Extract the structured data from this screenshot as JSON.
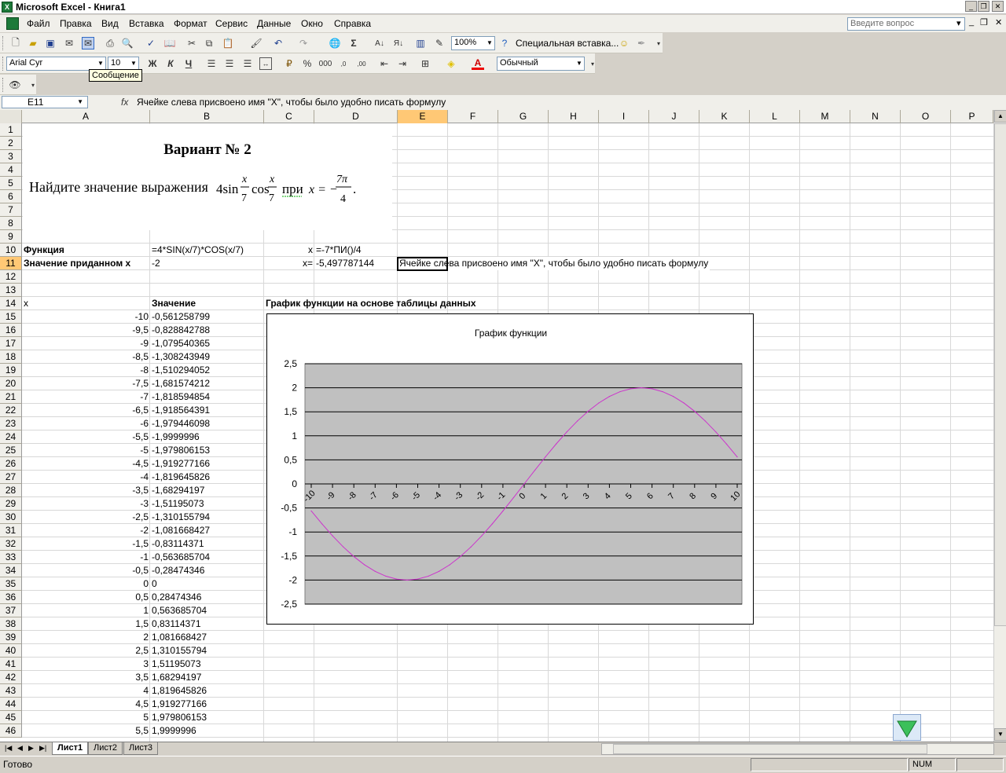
{
  "window": {
    "title": "Microsoft Excel - Книга1"
  },
  "menu": {
    "items": [
      "Файл",
      "Правка",
      "Вид",
      "Вставка",
      "Формат",
      "Сервис",
      "Данные",
      "Окно",
      "Справка"
    ],
    "ask_placeholder": "Введите вопрос"
  },
  "toolbar1": {
    "zoom": "100%",
    "special_paste": "Специальная вставка..."
  },
  "toolbar2": {
    "font": "Arial Cyr",
    "size": "10",
    "style": "Обычный"
  },
  "tooltip": "Сообщение",
  "formula_bar": {
    "cell_ref": "E11",
    "fx": "fx",
    "formula": "Ячейке слева присвоено имя \"X\", чтобы было удобно писать формулу"
  },
  "columns": [
    "A",
    "B",
    "C",
    "D",
    "E",
    "F",
    "G",
    "H",
    "I",
    "J",
    "K",
    "L",
    "M",
    "N",
    "O",
    "P"
  ],
  "rows": [
    "1",
    "2",
    "3",
    "4",
    "5",
    "6",
    "7",
    "8",
    "9",
    "10",
    "11",
    "12",
    "13",
    "14",
    "15",
    "16",
    "17",
    "18",
    "19",
    "20",
    "21",
    "22",
    "23",
    "24",
    "25",
    "26",
    "27",
    "28",
    "29",
    "30",
    "31",
    "32",
    "33",
    "34",
    "35",
    "36",
    "37",
    "38",
    "39",
    "40",
    "41",
    "42",
    "43",
    "44",
    "45",
    "46"
  ],
  "picture": {
    "heading": "Вариант № 2",
    "task_text": "Найдите значение выражения",
    "f_4sin": "4sin",
    "f_x": "x",
    "f_7": "7",
    "f_cos": "cos",
    "f_pri": "при",
    "f_xeq": "x = −",
    "f_7pi": "7π",
    "f_4": "4"
  },
  "cells": {
    "a10": "Функция",
    "b10": "=4*SIN(x/7)*COS(x/7)",
    "c10": "x",
    "d10": "=-7*ПИ()/4",
    "a11": "Значение приданном x",
    "b11": "-2",
    "c11": "x=",
    "d11": "-5,497787144",
    "e11": "Ячейке слева присвоено имя \"X\", чтобы было удобно писать формулу",
    "a14": "x",
    "b14": "Значение",
    "c14": "График функции на основе таблицы данных"
  },
  "table": {
    "x": [
      "-10",
      "-9,5",
      "-9",
      "-8,5",
      "-8",
      "-7,5",
      "-7",
      "-6,5",
      "-6",
      "-5,5",
      "-5",
      "-4,5",
      "-4",
      "-3,5",
      "-3",
      "-2,5",
      "-2",
      "-1,5",
      "-1",
      "-0,5",
      "0",
      "0,5",
      "1",
      "1,5",
      "2",
      "2,5",
      "3",
      "3,5",
      "4",
      "4,5",
      "5",
      "5,5"
    ],
    "y": [
      "-0,561258799",
      "-0,828842788",
      "-1,079540365",
      "-1,308243949",
      "-1,510294052",
      "-1,681574212",
      "-1,818594854",
      "-1,918564391",
      "-1,979446098",
      "-1,9999996",
      "-1,979806153",
      "-1,919277166",
      "-1,819645826",
      "-1,68294197",
      "-1,51195073",
      "-1,310155794",
      "-1,081668427",
      "-0,83114371",
      "-0,563685704",
      "-0,28474346",
      "0",
      "0,28474346",
      "0,563685704",
      "0,83114371",
      "1,081668427",
      "1,310155794",
      "1,51195073",
      "1,68294197",
      "1,819645826",
      "1,919277166",
      "1,979806153",
      "1,9999996"
    ]
  },
  "chart_data": {
    "type": "line",
    "title": "График функции",
    "x": [
      -10,
      -9.5,
      -9,
      -8.5,
      -8,
      -7.5,
      -7,
      -6.5,
      -6,
      -5.5,
      -5,
      -4.5,
      -4,
      -3.5,
      -3,
      -2.5,
      -2,
      -1.5,
      -1,
      -0.5,
      0,
      0.5,
      1,
      1.5,
      2,
      2.5,
      3,
      3.5,
      4,
      4.5,
      5,
      5.5,
      6,
      6.5,
      7,
      7.5,
      8,
      8.5,
      9,
      9.5,
      10
    ],
    "series": [
      {
        "values": [
          -0.5613,
          -0.8288,
          -1.0795,
          -1.3082,
          -1.5103,
          -1.6816,
          -1.8186,
          -1.9186,
          -1.9794,
          -2.0,
          -1.9798,
          -1.9193,
          -1.8196,
          -1.6829,
          -1.512,
          -1.3102,
          -1.0817,
          -0.8311,
          -0.5637,
          -0.2847,
          0,
          0.2847,
          0.5637,
          0.8311,
          1.0817,
          1.3102,
          1.512,
          1.6829,
          1.8196,
          1.9193,
          1.9798,
          2.0,
          1.9794,
          1.9186,
          1.8186,
          1.6816,
          1.5103,
          1.3082,
          1.0795,
          0.8288,
          0.5613
        ]
      }
    ],
    "x_tick_labels": [
      "-10",
      "-9",
      "-8",
      "-7",
      "-6",
      "-5",
      "-4",
      "-3",
      "-2",
      "-1",
      "0",
      "1",
      "2",
      "3",
      "4",
      "5",
      "6",
      "7",
      "8",
      "9",
      "10"
    ],
    "y_tick_labels": [
      "2,5",
      "2",
      "1,5",
      "1",
      "0,5",
      "0",
      "-0,5",
      "-1",
      "-1,5",
      "-2",
      "-2,5"
    ],
    "ylim": [
      -2.5,
      2.5
    ],
    "xlim": [
      -10,
      10
    ],
    "grid": true,
    "line_color": "#cc33cc",
    "plot_bg": "#c0c0c0"
  },
  "sheet_tabs": [
    "Лист1",
    "Лист2",
    "Лист3"
  ],
  "status": {
    "ready": "Готово",
    "num": "NUM"
  }
}
